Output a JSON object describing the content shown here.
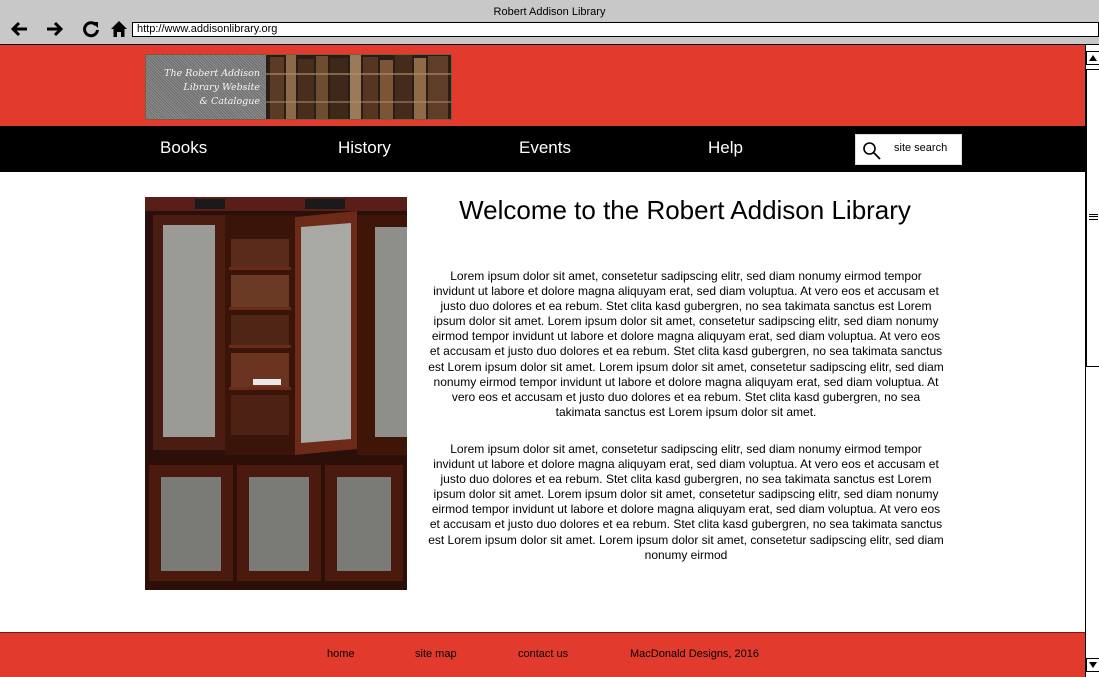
{
  "window": {
    "title": "Robert Addison Library"
  },
  "browser": {
    "url": "http://www.addisonlibrary.org",
    "icons": [
      "back-arrow-icon",
      "forward-arrow-icon",
      "reload-icon",
      "home-icon"
    ]
  },
  "header": {
    "logo_lines": [
      "The Robert Addison",
      "Library Website",
      "& Catalogue"
    ],
    "accent_color": "#e33a2e"
  },
  "nav": {
    "items": [
      "Books",
      "History",
      "Events",
      "Help"
    ],
    "search_placeholder": "site search",
    "search_icon": "search-icon"
  },
  "main": {
    "title": "Welcome to the Robert Addison Library",
    "paragraphs": [
      "Lorem ipsum dolor sit amet, consetetur sadipscing elitr, sed diam nonumy eirmod tempor invidunt ut labore et dolore magna aliquyam erat, sed diam voluptua. At vero eos et accusam et justo duo dolores et ea rebum. Stet clita kasd gubergren, no sea takimata sanctus est Lorem ipsum dolor sit amet. Lorem ipsum dolor sit amet, consetetur sadipscing elitr, sed diam nonumy eirmod tempor invidunt ut labore et dolore magna aliquyam erat, sed diam voluptua. At vero eos et accusam et justo duo dolores et ea rebum. Stet clita kasd gubergren, no sea takimata sanctus est Lorem ipsum dolor sit amet. Lorem ipsum dolor sit amet, consetetur sadipscing elitr, sed diam nonumy eirmod tempor invidunt ut labore et dolore magna aliquyam erat, sed diam voluptua. At vero eos et accusam et justo duo dolores et ea rebum. Stet clita kasd gubergren, no sea takimata sanctus est Lorem ipsum dolor sit amet.",
      "Lorem ipsum dolor sit amet, consetetur sadipscing elitr, sed diam nonumy eirmod tempor invidunt ut labore et dolore magna aliquyam erat, sed diam voluptua. At vero eos et accusam et justo duo dolores et ea rebum. Stet clita kasd gubergren, no sea takimata sanctus est Lorem ipsum dolor sit amet. Lorem ipsum dolor sit amet, consetetur sadipscing elitr, sed diam nonumy eirmod tempor invidunt ut labore et dolore magna aliquyam erat, sed diam voluptua. At vero eos et accusam et justo duo dolores et ea rebum. Stet clita kasd gubergren, no sea takimata sanctus est Lorem ipsum dolor sit amet. Lorem ipsum dolor sit amet, consetetur sadipscing elitr, sed diam nonumy eirmod"
    ]
  },
  "footer": {
    "links": [
      "home",
      "site map",
      "contact us"
    ],
    "credit": "MacDonald Designs, 2016"
  }
}
